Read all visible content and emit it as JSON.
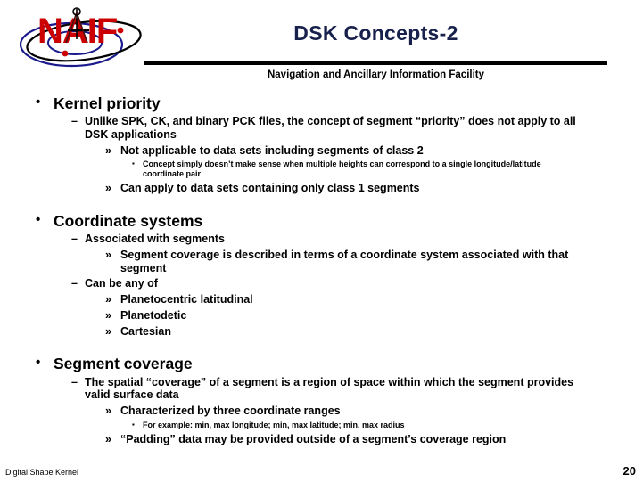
{
  "header": {
    "logo_alt": "NAIF",
    "logo_letters": "NAIF",
    "title": "DSK Concepts-2",
    "subtitle": "Navigation and Ancillary Information Facility",
    "title_color": "#18214C",
    "logo_red": "#CC0000",
    "logo_blue": "#1A1A8C",
    "rule_color": "#000000"
  },
  "outline": [
    {
      "level": 1,
      "marker": "•",
      "text": "Kernel priority"
    },
    {
      "level": 2,
      "marker": "–",
      "text": "Unlike SPK, CK, and binary PCK files, the concept of segment “priority” does not apply to all DSK applications"
    },
    {
      "level": 3,
      "marker": "»",
      "text": "Not applicable to data sets including segments of class 2"
    },
    {
      "level": 4,
      "marker": "▪",
      "text": "Concept simply doesn’t make sense when multiple heights can correspond to a single longitude/latitude coordinate pair"
    },
    {
      "level": 3,
      "marker": "»",
      "text": "Can apply to data sets containing only class 1 segments"
    },
    {
      "level": 1,
      "marker": "•",
      "text": "Coordinate systems"
    },
    {
      "level": 2,
      "marker": "–",
      "text": "Associated with segments"
    },
    {
      "level": 3,
      "marker": "»",
      "text": "Segment coverage is described in terms of a coordinate system associated with that segment"
    },
    {
      "level": 2,
      "marker": "–",
      "text": "Can be any of"
    },
    {
      "level": 3,
      "marker": "»",
      "text": "Planetocentric latitudinal"
    },
    {
      "level": 3,
      "marker": "»",
      "text": "Planetodetic"
    },
    {
      "level": 3,
      "marker": "»",
      "text": "Cartesian"
    },
    {
      "level": 1,
      "marker": "•",
      "text": "Segment coverage"
    },
    {
      "level": 2,
      "marker": "–",
      "text": "The spatial “coverage” of a segment is a region of  space within which the segment provides valid surface data"
    },
    {
      "level": 3,
      "marker": "»",
      "text": "Characterized by three coordinate ranges"
    },
    {
      "level": 4,
      "marker": "▪",
      "text": "For example: min, max longitude; min, max latitude; min, max radius"
    },
    {
      "level": 3,
      "marker": "»",
      "text": "“Padding” data may be provided outside of a segment’s coverage region"
    }
  ],
  "footer": {
    "label": "Digital Shape Kernel",
    "page_number": "20"
  }
}
